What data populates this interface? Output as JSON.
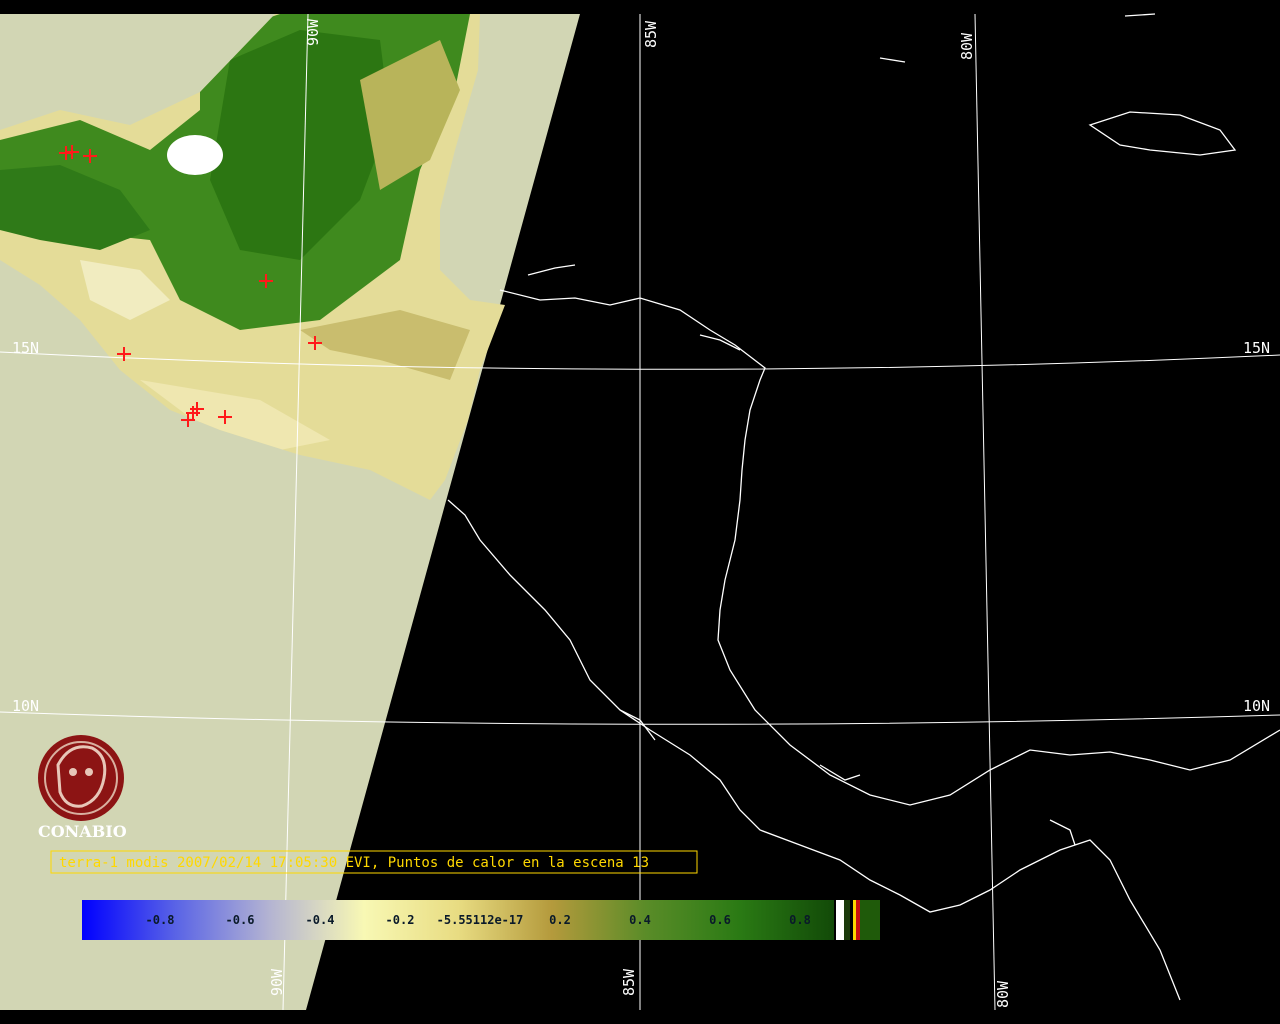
{
  "caption": "terra-1 modis 2007/02/14 17:05:30 EVI, Puntos de calor en la escena 13",
  "organization": "CONABIO",
  "graticule": {
    "latitudes": [
      {
        "label_left": "15N",
        "label_right": "15N"
      },
      {
        "label_left": "10N",
        "label_right": "10N"
      }
    ],
    "longitudes": [
      {
        "label_top": "90W",
        "label_bottom": "90W"
      },
      {
        "label_top": "85W",
        "label_bottom": "85W"
      },
      {
        "label_top": "80W",
        "label_bottom": "80W"
      }
    ]
  },
  "legend": {
    "ticks": [
      "-0.8",
      "-0.6",
      "-0.4",
      "-0.2",
      "-5.55112e-17",
      "0.2",
      "0.4",
      "0.6",
      "0.8"
    ],
    "colors": [
      "#0000ff",
      "#5a64e6",
      "#b4b4d2",
      "#f8f8b4",
      "#e8dc82",
      "#b49a3c",
      "#5a8c28",
      "#2a7a14",
      "#124a08"
    ]
  },
  "colors": {
    "background": "#000000",
    "swath_fill": "#d2d6b4",
    "coastline": "#ffffff",
    "graticule": "#ffffff",
    "hotspot": "#ff1a1a",
    "caption_text": "#ffd800",
    "logo": "#8c1414"
  },
  "hotspots_count": 10
}
